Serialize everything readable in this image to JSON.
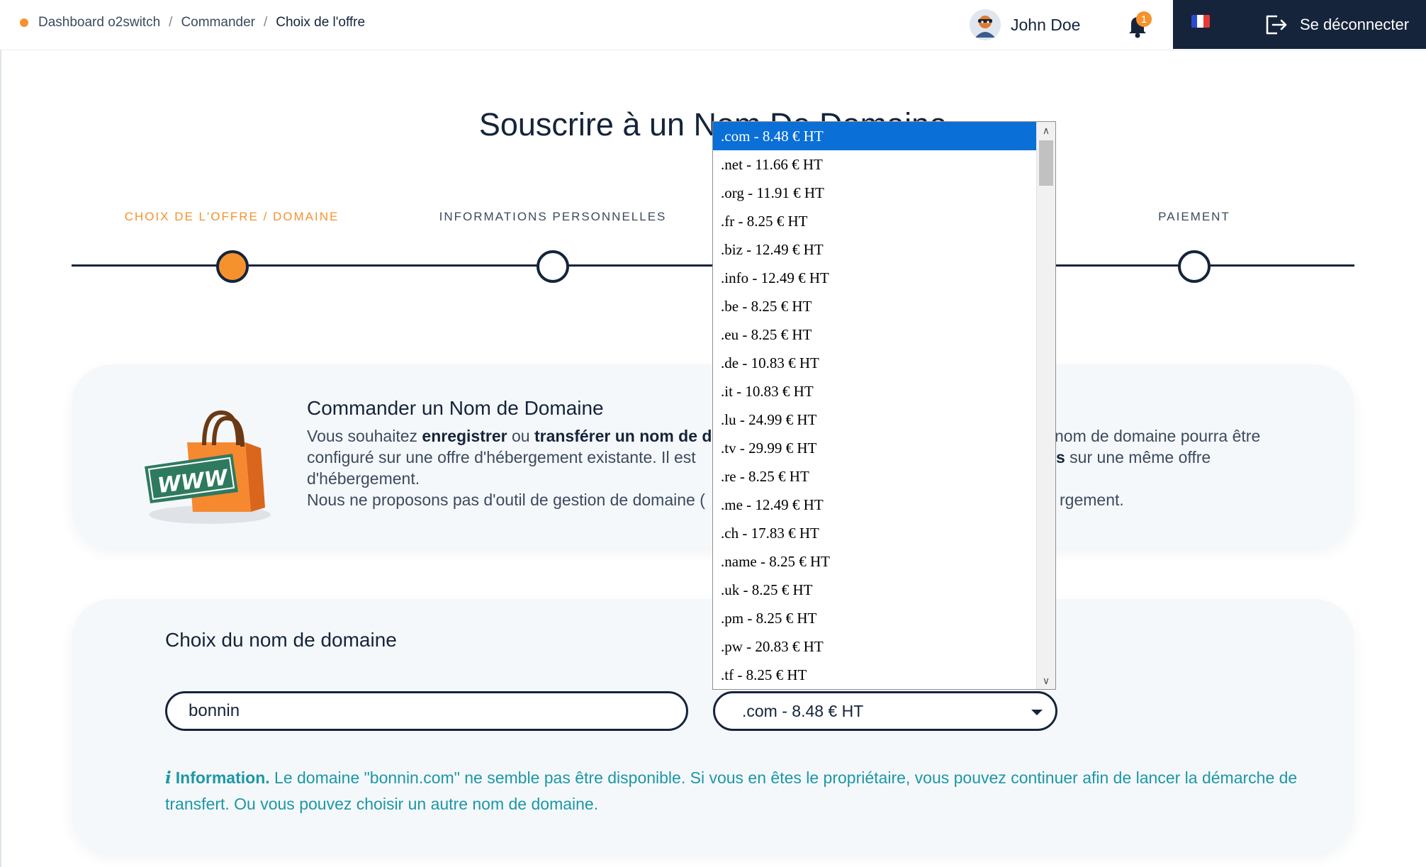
{
  "breadcrumb": {
    "items": [
      "Dashboard o2switch",
      "Commander",
      "Choix de l'offre"
    ],
    "separator": "/"
  },
  "header": {
    "user_name": "John Doe",
    "notification_count": "1",
    "language_flag": "fr-flag-icon",
    "logout_label": "Se déconnecter"
  },
  "page": {
    "title": "Souscrire à un Nom De Domaine"
  },
  "stepper": {
    "steps": [
      {
        "label": "CHOIX DE L'OFFRE / DOMAINE",
        "state": "active"
      },
      {
        "label": "INFORMATIONS PERSONNELLES",
        "state": "inactive"
      },
      {
        "label": "",
        "state": "inactive"
      },
      {
        "label": "PAIEMENT",
        "state": "inactive"
      }
    ]
  },
  "intro_card": {
    "title": "Commander un Nom de Domaine",
    "line1_pre": "Vous souhaitez ",
    "line1_bold1": "enregistrer",
    "line1_mid": " ou ",
    "line1_bold2": "transférer un nom de d",
    "line1_tail": "nom de domaine pourra être",
    "line2_pre": "configuré sur une offre d'hébergement existante. Il est",
    "line2_bold": "s",
    "line2_tail": " sur une même offre",
    "line3": "d'hébergement.",
    "line4_pre": "Nous ne proposons pas d'outil de gestion de domaine (",
    "line4_tail": "rgement.",
    "bag_text": "WWW"
  },
  "domain_card": {
    "title": "Choix du nom de domaine",
    "domain_value": "bonnin",
    "selected_extension": ".com - 8.48 € HT",
    "info_icon": "info-icon",
    "info_label": "Information.",
    "info_text": "Le domaine \"bonnin.com\" ne semble pas être disponible. Si vous en êtes le propriétaire, vous pouvez continuer afin de lancer la démarche de transfert. Ou vous pouvez choisir un autre nom de domaine."
  },
  "extension_dropdown": {
    "options": [
      ".com - 8.48 € HT",
      ".net - 11.66 € HT",
      ".org - 11.91 € HT",
      ".fr - 8.25 € HT",
      ".biz - 12.49 € HT",
      ".info - 12.49 € HT",
      ".be - 8.25 € HT",
      ".eu - 8.25 € HT",
      ".de - 10.83 € HT",
      ".it - 10.83 € HT",
      ".lu - 24.99 € HT",
      ".tv - 29.99 € HT",
      ".re - 8.25 € HT",
      ".me - 12.49 € HT",
      ".ch - 17.83 € HT",
      ".name - 8.25 € HT",
      ".uk - 8.25 € HT",
      ".pm - 8.25 € HT",
      ".pw - 20.83 € HT",
      ".tf - 8.25 € HT"
    ],
    "selected_index": 0
  },
  "colors": {
    "accent": "#f5922e",
    "navy": "#15243a",
    "info": "#1c97a6",
    "selection": "#0a6fd6",
    "card_bg": "#f5f8fb"
  }
}
